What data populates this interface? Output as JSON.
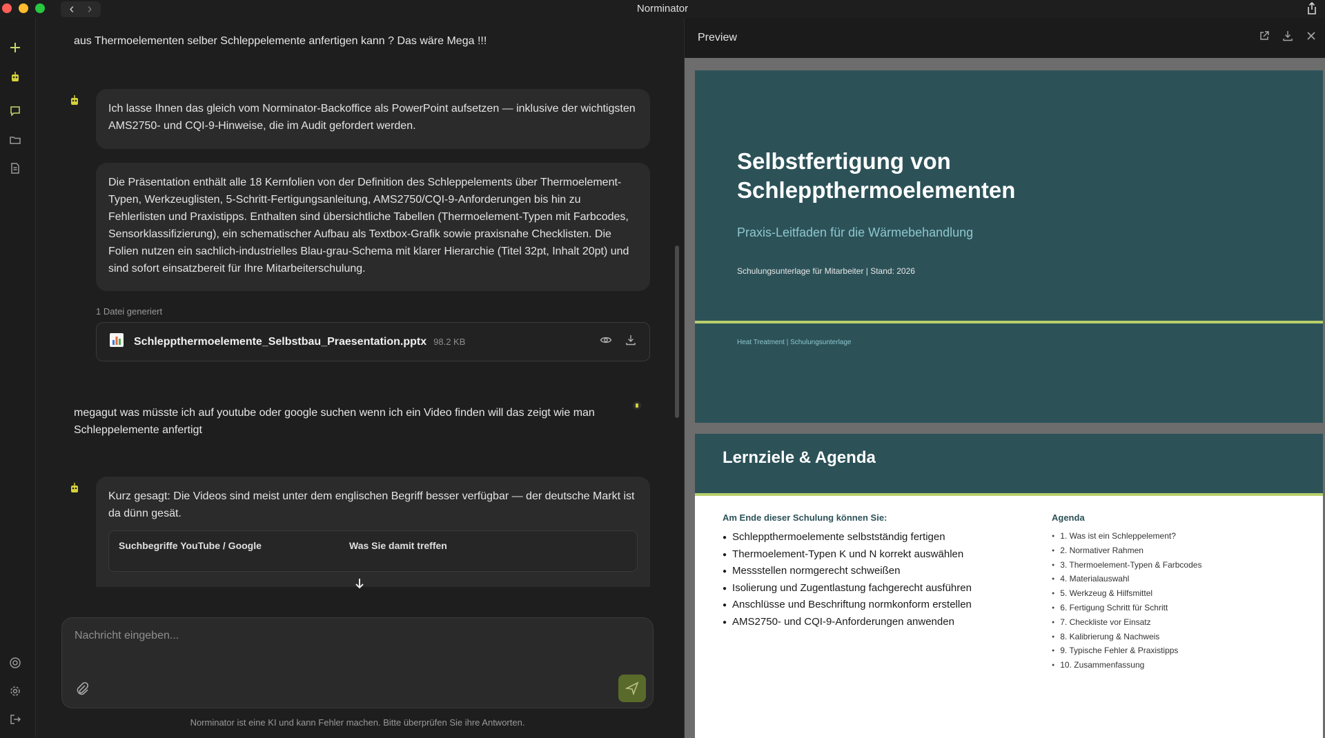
{
  "window": {
    "title": "Norminator"
  },
  "colors": {
    "accent": "#5a6a2a",
    "slide_teal": "#2c5258",
    "slide_rule": "#b8cf6a"
  },
  "chat": {
    "user_msg_1": "aus Thermoelementen selber Schleppelemente anfertigen kann ? Das wäre Mega !!!",
    "bot_msg_1": "Ich lasse Ihnen das gleich vom Norminator-Backoffice als PowerPoint aufsetzen — inklusive der wichtigsten AMS2750- und CQI-9-Hinweise, die im Audit gefordert werden.",
    "bot_msg_2": "Die Präsentation enthält alle 18 Kernfolien von der Definition des Schleppelements über Thermoelement-Typen, Werkzeuglisten, 5-Schritt-Fertigungsanleitung, AMS2750/CQI-9-Anforderungen bis hin zu Fehlerlisten und Praxistipps. Enthalten sind übersichtliche Tabellen (Thermoelement-Typen mit Farbcodes, Sensorklassifizierung), ein schematischer Aufbau als Textbox-Grafik sowie praxisnahe Checklisten. Die Folien nutzen ein sachlich-industrielles Blau-grau-Schema mit klarer Hierarchie (Titel 32pt, Inhalt 20pt) und sind sofort einsatzbereit für Ihre Mitarbeiterschulung.",
    "files_label": "1 Datei generiert",
    "file": {
      "name": "Schleppthermoelemente_Selbstbau_Praesentation.pptx",
      "size": "98.2 KB"
    },
    "user_msg_2": "megagut was müsste ich auf youtube oder google suchen wenn ich ein Video finden will das zeigt wie man Schleppelemente anfertigt",
    "bot_msg_3": "Kurz gesagt: Die Videos sind meist unter dem englischen Begriff besser verfügbar — der deutsche Markt ist da dünn gesät.",
    "table": {
      "col1": "Suchbegriffe YouTube / Google",
      "col2": "Was Sie damit treffen"
    }
  },
  "composer": {
    "placeholder": "Nachricht eingeben...",
    "disclaimer": "Norminator ist eine KI und kann Fehler machen. Bitte überprüfen Sie ihre Antworten."
  },
  "preview": {
    "title": "Preview",
    "slide1": {
      "title_line1": "Selbstfertigung von",
      "title_line2": "Schleppthermoelementen",
      "subtitle": "Praxis-Leitfaden für die Wärmebehandlung",
      "meta": "Schulungsunterlage für Mitarbeiter | Stand: 2026",
      "footer": "Heat Treatment | Schulungsunterlage"
    },
    "slide2": {
      "title": "Lernziele & Agenda",
      "left_heading": "Am Ende dieser Schulung können Sie:",
      "goals": [
        "Schleppthermoelemente selbstständig fertigen",
        "Thermoelement-Typen K und N korrekt auswählen",
        "Messstellen normgerecht schweißen",
        "Isolierung und Zugentlastung fachgerecht ausführen",
        "Anschlüsse und Beschriftung normkonform erstellen",
        "AMS2750- und CQI-9-Anforderungen anwenden"
      ],
      "right_heading": "Agenda",
      "agenda": [
        "1. Was ist ein Schleppelement?",
        "2. Normativer Rahmen",
        "3. Thermoelement-Typen & Farbcodes",
        "4. Materialauswahl",
        "5. Werkzeug & Hilfsmittel",
        "6. Fertigung Schritt für Schritt",
        "7. Checkliste vor Einsatz",
        "8. Kalibrierung & Nachweis",
        "9. Typische Fehler & Praxistipps",
        "10. Zusammenfassung"
      ]
    }
  }
}
